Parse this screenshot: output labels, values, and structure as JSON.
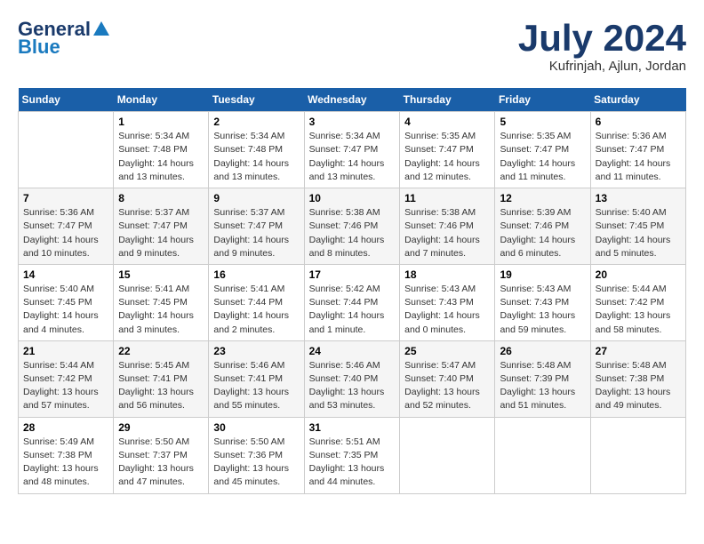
{
  "header": {
    "logo_general": "General",
    "logo_blue": "Blue",
    "month_title": "July 2024",
    "location": "Kufrinjah, Ajlun, Jordan"
  },
  "calendar": {
    "days_of_week": [
      "Sunday",
      "Monday",
      "Tuesday",
      "Wednesday",
      "Thursday",
      "Friday",
      "Saturday"
    ],
    "weeks": [
      [
        {
          "day": null,
          "info": ""
        },
        {
          "day": "1",
          "info": "Sunrise: 5:34 AM\nSunset: 7:48 PM\nDaylight: 14 hours\nand 13 minutes."
        },
        {
          "day": "2",
          "info": "Sunrise: 5:34 AM\nSunset: 7:48 PM\nDaylight: 14 hours\nand 13 minutes."
        },
        {
          "day": "3",
          "info": "Sunrise: 5:34 AM\nSunset: 7:47 PM\nDaylight: 14 hours\nand 13 minutes."
        },
        {
          "day": "4",
          "info": "Sunrise: 5:35 AM\nSunset: 7:47 PM\nDaylight: 14 hours\nand 12 minutes."
        },
        {
          "day": "5",
          "info": "Sunrise: 5:35 AM\nSunset: 7:47 PM\nDaylight: 14 hours\nand 11 minutes."
        },
        {
          "day": "6",
          "info": "Sunrise: 5:36 AM\nSunset: 7:47 PM\nDaylight: 14 hours\nand 11 minutes."
        }
      ],
      [
        {
          "day": "7",
          "info": "Sunrise: 5:36 AM\nSunset: 7:47 PM\nDaylight: 14 hours\nand 10 minutes."
        },
        {
          "day": "8",
          "info": "Sunrise: 5:37 AM\nSunset: 7:47 PM\nDaylight: 14 hours\nand 9 minutes."
        },
        {
          "day": "9",
          "info": "Sunrise: 5:37 AM\nSunset: 7:47 PM\nDaylight: 14 hours\nand 9 minutes."
        },
        {
          "day": "10",
          "info": "Sunrise: 5:38 AM\nSunset: 7:46 PM\nDaylight: 14 hours\nand 8 minutes."
        },
        {
          "day": "11",
          "info": "Sunrise: 5:38 AM\nSunset: 7:46 PM\nDaylight: 14 hours\nand 7 minutes."
        },
        {
          "day": "12",
          "info": "Sunrise: 5:39 AM\nSunset: 7:46 PM\nDaylight: 14 hours\nand 6 minutes."
        },
        {
          "day": "13",
          "info": "Sunrise: 5:40 AM\nSunset: 7:45 PM\nDaylight: 14 hours\nand 5 minutes."
        }
      ],
      [
        {
          "day": "14",
          "info": "Sunrise: 5:40 AM\nSunset: 7:45 PM\nDaylight: 14 hours\nand 4 minutes."
        },
        {
          "day": "15",
          "info": "Sunrise: 5:41 AM\nSunset: 7:45 PM\nDaylight: 14 hours\nand 3 minutes."
        },
        {
          "day": "16",
          "info": "Sunrise: 5:41 AM\nSunset: 7:44 PM\nDaylight: 14 hours\nand 2 minutes."
        },
        {
          "day": "17",
          "info": "Sunrise: 5:42 AM\nSunset: 7:44 PM\nDaylight: 14 hours\nand 1 minute."
        },
        {
          "day": "18",
          "info": "Sunrise: 5:43 AM\nSunset: 7:43 PM\nDaylight: 14 hours\nand 0 minutes."
        },
        {
          "day": "19",
          "info": "Sunrise: 5:43 AM\nSunset: 7:43 PM\nDaylight: 13 hours\nand 59 minutes."
        },
        {
          "day": "20",
          "info": "Sunrise: 5:44 AM\nSunset: 7:42 PM\nDaylight: 13 hours\nand 58 minutes."
        }
      ],
      [
        {
          "day": "21",
          "info": "Sunrise: 5:44 AM\nSunset: 7:42 PM\nDaylight: 13 hours\nand 57 minutes."
        },
        {
          "day": "22",
          "info": "Sunrise: 5:45 AM\nSunset: 7:41 PM\nDaylight: 13 hours\nand 56 minutes."
        },
        {
          "day": "23",
          "info": "Sunrise: 5:46 AM\nSunset: 7:41 PM\nDaylight: 13 hours\nand 55 minutes."
        },
        {
          "day": "24",
          "info": "Sunrise: 5:46 AM\nSunset: 7:40 PM\nDaylight: 13 hours\nand 53 minutes."
        },
        {
          "day": "25",
          "info": "Sunrise: 5:47 AM\nSunset: 7:40 PM\nDaylight: 13 hours\nand 52 minutes."
        },
        {
          "day": "26",
          "info": "Sunrise: 5:48 AM\nSunset: 7:39 PM\nDaylight: 13 hours\nand 51 minutes."
        },
        {
          "day": "27",
          "info": "Sunrise: 5:48 AM\nSunset: 7:38 PM\nDaylight: 13 hours\nand 49 minutes."
        }
      ],
      [
        {
          "day": "28",
          "info": "Sunrise: 5:49 AM\nSunset: 7:38 PM\nDaylight: 13 hours\nand 48 minutes."
        },
        {
          "day": "29",
          "info": "Sunrise: 5:50 AM\nSunset: 7:37 PM\nDaylight: 13 hours\nand 47 minutes."
        },
        {
          "day": "30",
          "info": "Sunrise: 5:50 AM\nSunset: 7:36 PM\nDaylight: 13 hours\nand 45 minutes."
        },
        {
          "day": "31",
          "info": "Sunrise: 5:51 AM\nSunset: 7:35 PM\nDaylight: 13 hours\nand 44 minutes."
        },
        {
          "day": null,
          "info": ""
        },
        {
          "day": null,
          "info": ""
        },
        {
          "day": null,
          "info": ""
        }
      ]
    ]
  }
}
